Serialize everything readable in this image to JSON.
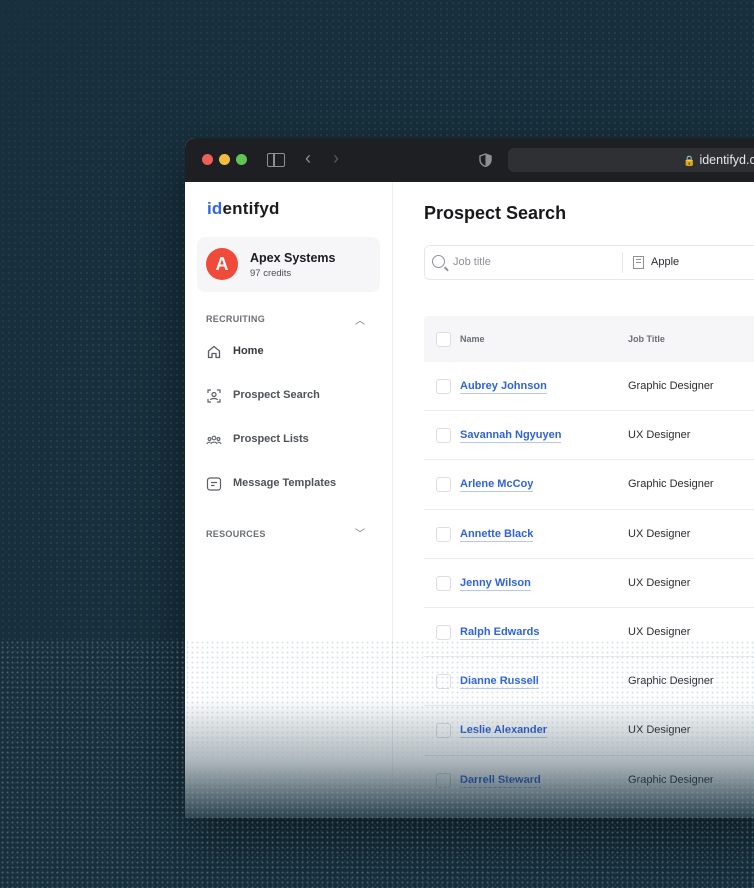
{
  "browser": {
    "url": "identifyd.co"
  },
  "app": {
    "logo_prefix": "id",
    "logo_suffix": "entifyd",
    "account": {
      "initial": "A",
      "name": "Apex Systems",
      "credits": "97 credits",
      "avatar_color": "#ef4a3a"
    },
    "sections": {
      "recruiting": "RECRUITING",
      "resources": "RESOURCES"
    },
    "nav": [
      {
        "label": "Home",
        "icon": "home-icon"
      },
      {
        "label": "Prospect Search",
        "icon": "scan-user-icon"
      },
      {
        "label": "Prospect Lists",
        "icon": "users-icon"
      },
      {
        "label": "Message Templates",
        "icon": "message-icon"
      }
    ]
  },
  "main": {
    "title": "Prospect Search",
    "filters": {
      "job_placeholder": "Job title",
      "company": "Apple"
    },
    "table": {
      "columns": [
        "Name",
        "Job Title"
      ],
      "rows": [
        {
          "name": "Aubrey Johnson",
          "title": "Graphic Designer"
        },
        {
          "name": "Savannah Ngyuyen",
          "title": "UX Designer"
        },
        {
          "name": "Arlene McCoy",
          "title": "Graphic Designer"
        },
        {
          "name": "Annette Black",
          "title": "UX Designer"
        },
        {
          "name": "Jenny Wilson",
          "title": "UX Designer"
        },
        {
          "name": "Ralph Edwards",
          "title": "UX Designer"
        },
        {
          "name": "Dianne Russell",
          "title": "Graphic Designer"
        },
        {
          "name": "Leslie Alexander",
          "title": "UX Designer"
        },
        {
          "name": "Darrell Steward",
          "title": "Graphic Designer"
        }
      ]
    }
  },
  "colors": {
    "background": "#18303d",
    "accent": "#3366e6",
    "link": "#3062d8"
  }
}
